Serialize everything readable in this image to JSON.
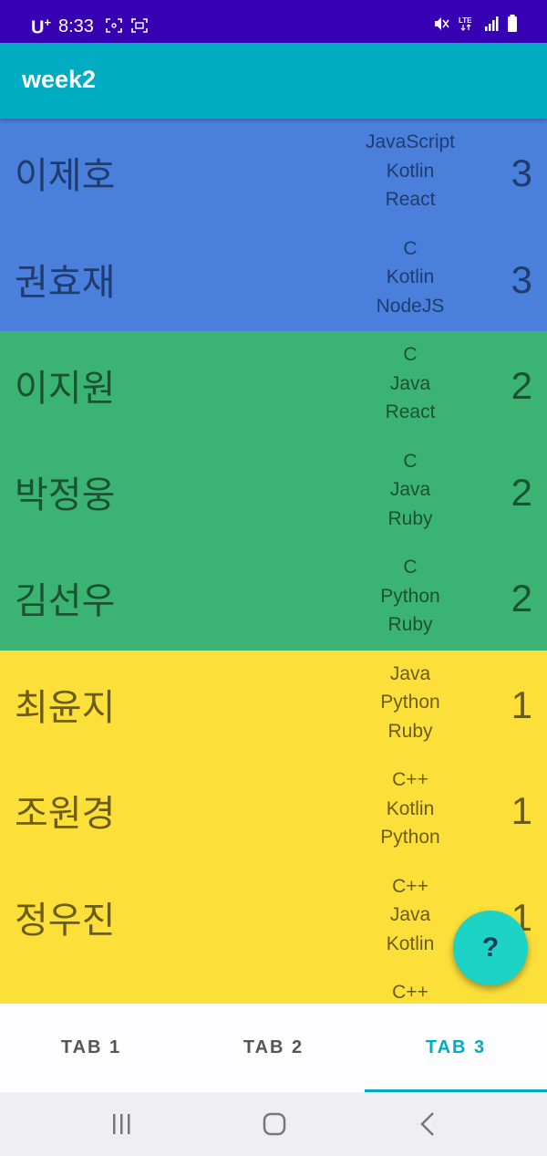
{
  "status_bar": {
    "carrier": "U",
    "carrier_sup": "+",
    "time": "8:33"
  },
  "app_bar": {
    "title": "week2"
  },
  "colors": {
    "group_3": "#4a7fdc",
    "group_2": "#3bb372",
    "group_1": "#fddf3a",
    "text_on_blue": "#1e3d6e",
    "text_on_green": "#1b5234",
    "text_on_yellow": "#6b5c16",
    "accent": "#00acc1",
    "fab": "#1dd3c5"
  },
  "list": [
    {
      "name": "이제호",
      "skills": [
        "JavaScript",
        "Kotlin",
        "React"
      ],
      "count": "3",
      "group": 3
    },
    {
      "name": "권효재",
      "skills": [
        "C",
        "Kotlin",
        "NodeJS"
      ],
      "count": "3",
      "group": 3
    },
    {
      "name": "이지원",
      "skills": [
        "C",
        "Java",
        "React"
      ],
      "count": "2",
      "group": 2
    },
    {
      "name": "박정웅",
      "skills": [
        "C",
        "Java",
        "Ruby"
      ],
      "count": "2",
      "group": 2
    },
    {
      "name": "김선우",
      "skills": [
        "C",
        "Python",
        "Ruby"
      ],
      "count": "2",
      "group": 2
    },
    {
      "name": "최윤지",
      "skills": [
        "Java",
        "Python",
        "Ruby"
      ],
      "count": "1",
      "group": 1
    },
    {
      "name": "조원경",
      "skills": [
        "C++",
        "Kotlin",
        "Python"
      ],
      "count": "1",
      "group": 1
    },
    {
      "name": "정우진",
      "skills": [
        "C++",
        "Java",
        "Kotlin"
      ],
      "count": "1",
      "group": 1
    },
    {
      "name": "",
      "skills": [
        "C++",
        "",
        ""
      ],
      "count": "",
      "group": 1
    }
  ],
  "fab": {
    "label": "?"
  },
  "tabs": [
    {
      "label": "TAB 1",
      "selected": false
    },
    {
      "label": "TAB 2",
      "selected": false
    },
    {
      "label": "TAB 3",
      "selected": true
    }
  ],
  "nav_bar": {
    "buttons": [
      "recent-apps-icon",
      "home-icon",
      "back-icon"
    ]
  }
}
